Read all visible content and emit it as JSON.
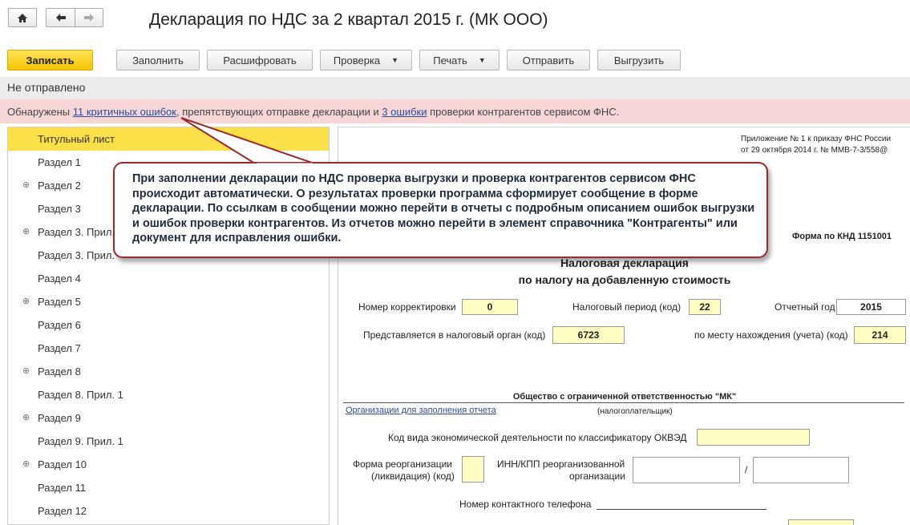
{
  "window": {
    "title": "Декларация по НДС за 2 квартал 2015 г. (МК ООО)"
  },
  "nav": {
    "home_icon": "home-icon",
    "back_icon": "arrow-left-icon",
    "forward_icon": "arrow-right-icon"
  },
  "toolbar": {
    "save_label": "Записать",
    "fill_label": "Заполнить",
    "decode_label": "Расшифровать",
    "check_label": "Проверка",
    "print_label": "Печать",
    "send_label": "Отправить",
    "export_label": "Выгрузить"
  },
  "status": {
    "text": "Не отправлено"
  },
  "errors": {
    "prefix": "Обнаружены ",
    "critical_link": "11 критичных ошибок",
    "middle": ", препятствующих отправке декларации и ",
    "counterparty_link": "3 ошибки",
    "suffix": " проверки контрагентов сервисом ФНС."
  },
  "sections": [
    {
      "label": "Титульный лист",
      "expandable": false,
      "active": true
    },
    {
      "label": "Раздел 1",
      "expandable": false
    },
    {
      "label": "Раздел 2",
      "expandable": true
    },
    {
      "label": "Раздел 3",
      "expandable": false
    },
    {
      "label": "Раздел 3. Прил.",
      "expandable": true
    },
    {
      "label": "Раздел 3. Прил.",
      "expandable": false
    },
    {
      "label": "Раздел 4",
      "expandable": false
    },
    {
      "label": "Раздел 5",
      "expandable": true
    },
    {
      "label": "Раздел 6",
      "expandable": false
    },
    {
      "label": "Раздел 7",
      "expandable": false
    },
    {
      "label": "Раздел 8",
      "expandable": true
    },
    {
      "label": "Раздел 8. Прил. 1",
      "expandable": false
    },
    {
      "label": "Раздел 9",
      "expandable": true
    },
    {
      "label": "Раздел 9. Прил. 1",
      "expandable": false
    },
    {
      "label": "Раздел 10",
      "expandable": true
    },
    {
      "label": "Раздел 11",
      "expandable": false
    },
    {
      "label": "Раздел 12",
      "expandable": false
    }
  ],
  "callout": {
    "text": "При заполнении декларации по НДС проверка выгрузки и проверка контрагентов сервисом ФНС происходит автоматически. О результатах проверки программа сформирует сообщение в форме декларации. По ссылкам в сообщении можно перейти в отчеты с подробным описанием ошибок выгрузки и ошибок проверки контрагентов. Из отчетов можно перейти в элемент справочника \"Контрагенты\" или документ для исправления ошибки."
  },
  "doc": {
    "appendix_line1": "Приложение № 1 к приказу ФНС России",
    "appendix_line2": "от 29 октября 2014 г. № ММВ-7-3/558@",
    "form_code": "Форма по КНД 1151001",
    "title1": "Налоговая декларация",
    "title2": "по налогу на добавленную стоимость",
    "correction_label": "Номер корректировки",
    "correction_value": "0",
    "period_label": "Налоговый период (код)",
    "period_value": "22",
    "year_label": "Отчетный год",
    "year_value": "2015",
    "tax_org_label": "Представляется в налоговый орган (код)",
    "tax_org_value": "6723",
    "location_label": "по месту нахождения (учета) (код)",
    "location_value": "214",
    "org_name": "Общество с ограниченной ответственностью \"МК\"",
    "org_link": "Организации для заполнения отчета",
    "taxpayer_caption": "(налогоплательщик)",
    "okved_label": "Код вида экономической деятельности по классификатору ОКВЭД",
    "reorg_label1": "Форма реорганизации",
    "reorg_label2": "(ликвидация) (код)",
    "inn_label1": "ИНН/КПП реорганизованной",
    "inn_label2": "организации",
    "inn_slash": "/",
    "phone_label": "Номер контактного телефона"
  }
}
